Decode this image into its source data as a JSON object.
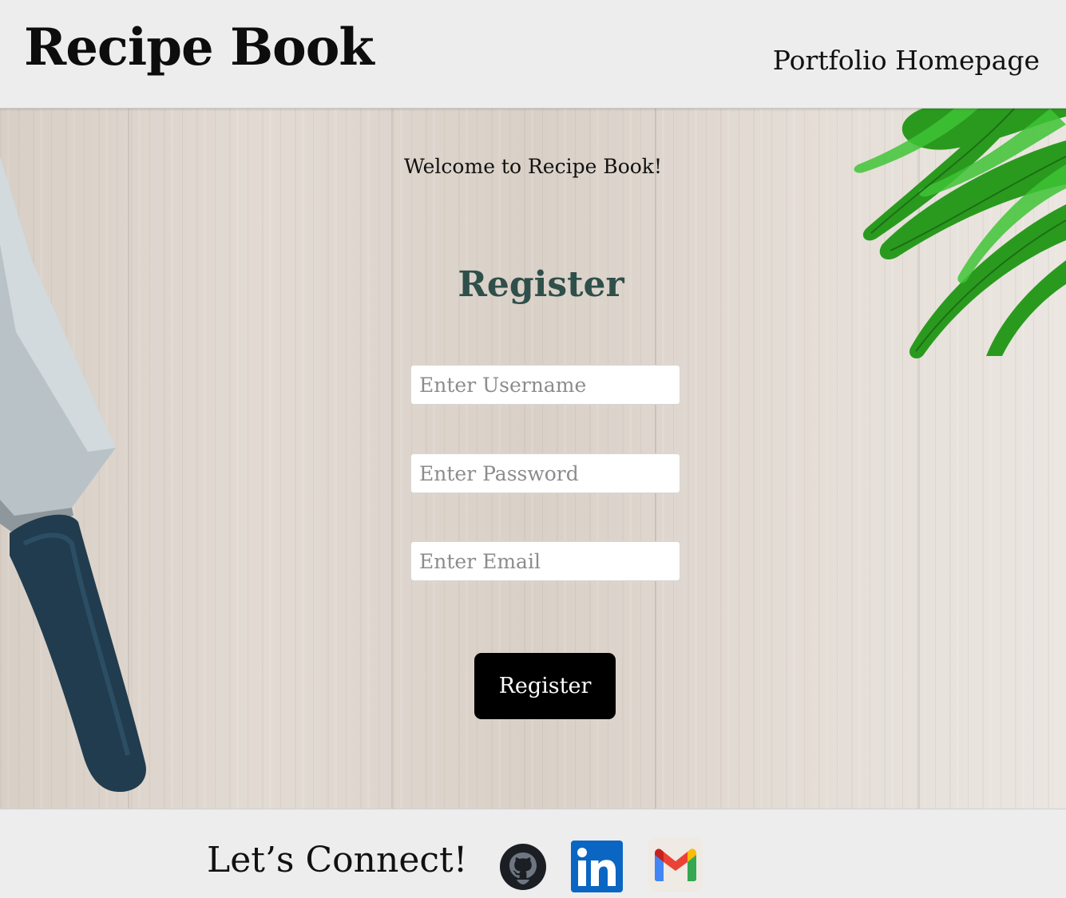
{
  "header": {
    "brand": "Recipe Book",
    "nav_link": "Portfolio Homepage"
  },
  "main": {
    "welcome": "Welcome to Recipe Book!",
    "form_title": "Register",
    "fields": [
      {
        "placeholder": "Enter Username",
        "value": ""
      },
      {
        "placeholder": "Enter Password",
        "value": ""
      },
      {
        "placeholder": "Enter Email",
        "value": ""
      }
    ],
    "submit_label": "Register"
  },
  "footer": {
    "connect_label": "Let’s Connect!",
    "social_icons": [
      "github-icon",
      "linkedin-icon",
      "gmail-icon"
    ]
  },
  "colors": {
    "header_bg": "#ededee",
    "title_accent": "#2f4f4a",
    "button_bg": "#000000",
    "linkedin_blue": "#0a66c2"
  }
}
